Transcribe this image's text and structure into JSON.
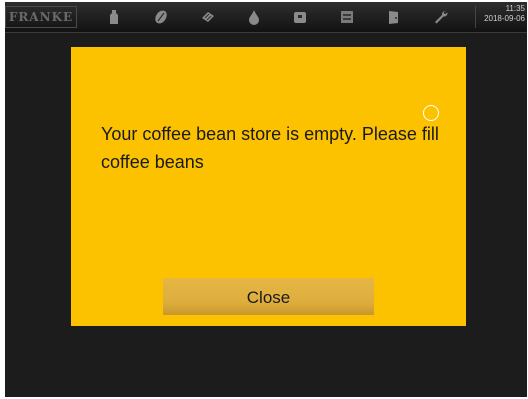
{
  "brand": {
    "logo_text": "FRANKE"
  },
  "topbar": {
    "icons": [
      "milk-bottle-icon",
      "coffee-bean-icon",
      "cleaning-tablet-icon",
      "water-drop-icon",
      "grounds-container-icon",
      "cup-heater-icon",
      "door-icon",
      "wrench-icon"
    ],
    "time": "11:35",
    "date": "2018-09-06"
  },
  "dialog": {
    "message": "Your coffee bean store is empty. Please fill coffee beans",
    "close_label": "Close"
  },
  "colors": {
    "dialog_background": "#fcc200",
    "button_background": "#e0b040",
    "screen_background": "#1c1c1c"
  }
}
